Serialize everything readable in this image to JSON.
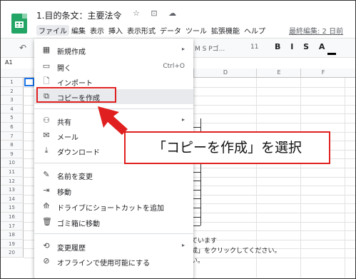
{
  "app": {
    "title": "1.目的条文：主要法令",
    "title_icons": "☆ ⊡ ☁",
    "last_edit": "最終編集: 2 日前"
  },
  "menubar": [
    "ファイル",
    "編集",
    "表示",
    "挿入",
    "表示形式",
    "データ",
    "ツール",
    "拡張機能",
    "ヘルプ"
  ],
  "toolbar": {
    "undo": "↶",
    "font": "M S Pゴ...",
    "size": "11",
    "format": "B I S A"
  },
  "cellref": "A1",
  "columns": [
    "D",
    "E",
    "F"
  ],
  "rows": [
    "1",
    "2",
    "3",
    "4",
    "5",
    "6",
    "7",
    "8",
    "9",
    "10",
    "11",
    "12",
    "13",
    "14",
    "15",
    "16",
    "17",
    "18",
    "19",
    "20"
  ],
  "sheet_text": {
    "line1": "ています",
    "line2": "成」をクリックしてください。",
    "line3": "い。"
  },
  "file_menu": {
    "items": [
      {
        "label": "新規作成",
        "icon": "new-icon",
        "glyph": "▦",
        "submenu": true
      },
      {
        "label": "開く",
        "icon": "folder-icon",
        "glyph": "▭",
        "shortcut": "Ctrl+O"
      },
      {
        "label": "インポート",
        "icon": "import-icon",
        "glyph": "🗋"
      },
      {
        "label": "コピーを作成",
        "icon": "copy-icon",
        "glyph": "⧉",
        "highlighted": true
      },
      {
        "label": "共有",
        "icon": "share-icon",
        "glyph": "⚇",
        "submenu": true
      },
      {
        "label": "メール",
        "icon": "mail-icon",
        "glyph": "✉",
        "submenu": true
      },
      {
        "label": "ダウンロード",
        "icon": "download-icon",
        "glyph": "⤓",
        "submenu": true
      },
      {
        "label": "名前を変更",
        "icon": "rename-icon",
        "glyph": "✎"
      },
      {
        "label": "移動",
        "icon": "move-icon",
        "glyph": "⇥"
      },
      {
        "label": "ドライブにショートカットを追加",
        "icon": "drive-shortcut-icon",
        "glyph": "⟰"
      },
      {
        "label": "ゴミ箱に移動",
        "icon": "trash-icon",
        "glyph": "🗑"
      },
      {
        "label": "変更履歴",
        "icon": "history-icon",
        "glyph": "⟲",
        "submenu": true
      },
      {
        "label": "オフラインで使用可能にする",
        "icon": "offline-icon",
        "glyph": "⊘"
      }
    ],
    "submenu_arrow": "▸"
  },
  "annotation": {
    "callout": "「コピーを作成」を選択",
    "color": "#e02020"
  }
}
